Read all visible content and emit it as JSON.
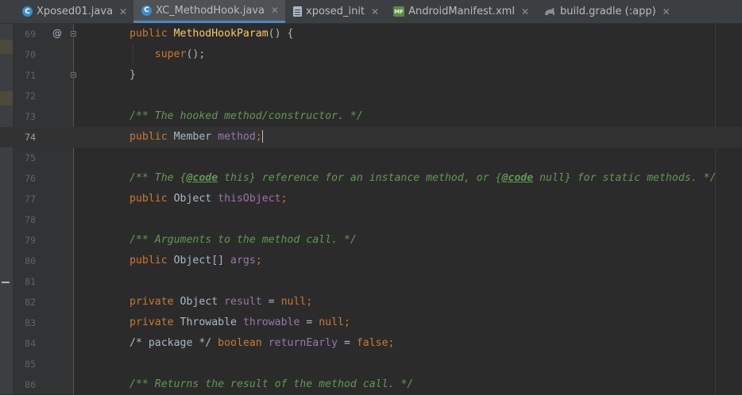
{
  "tabs": [
    {
      "label": "Xposed01.java",
      "icon": "java-class-icon",
      "active": false
    },
    {
      "label": "XC_MethodHook.java",
      "icon": "java-class-icon",
      "active": true
    },
    {
      "label": "xposed_init",
      "icon": "text-file-icon",
      "active": false
    },
    {
      "label": "AndroidManifest.xml",
      "icon": "manifest-icon",
      "active": false
    },
    {
      "label": "build.gradle (:app)",
      "icon": "gradle-icon",
      "active": false
    }
  ],
  "tab_icon_text": {
    "java": "C",
    "manifest": "MF"
  },
  "gutter": {
    "override_marker": "@"
  },
  "lines": [
    {
      "num": "69",
      "tokens": [
        [
          "kw",
          "public "
        ],
        [
          "fn",
          "MethodHookParam"
        ],
        [
          "p",
          "() {"
        ]
      ]
    },
    {
      "num": "70",
      "tokens": [
        [
          "p",
          "    "
        ],
        [
          "kw",
          "super"
        ],
        [
          "p",
          "();"
        ]
      ]
    },
    {
      "num": "71",
      "tokens": [
        [
          "p",
          "}"
        ]
      ]
    },
    {
      "num": "72",
      "tokens": []
    },
    {
      "num": "73",
      "tokens": [
        [
          "cm",
          "/** The hooked method/constructor. */"
        ]
      ]
    },
    {
      "num": "74",
      "current": true,
      "tokens": [
        [
          "kw",
          "public "
        ],
        [
          "p",
          "Member "
        ],
        [
          "fld",
          "method"
        ],
        [
          "kw",
          ";"
        ]
      ]
    },
    {
      "num": "75",
      "tokens": []
    },
    {
      "num": "76",
      "tokens": [
        [
          "cm",
          "/** The {"
        ],
        [
          "tag",
          "@code"
        ],
        [
          "cm",
          " this} reference for an instance method, or {"
        ],
        [
          "tag",
          "@code"
        ],
        [
          "cm",
          " null} for static methods. */"
        ]
      ]
    },
    {
      "num": "77",
      "tokens": [
        [
          "kw",
          "public "
        ],
        [
          "p",
          "Object "
        ],
        [
          "fld",
          "thisObject"
        ],
        [
          "kw",
          ";"
        ]
      ]
    },
    {
      "num": "78",
      "tokens": []
    },
    {
      "num": "79",
      "tokens": [
        [
          "cm",
          "/** Arguments to the method call. */"
        ]
      ]
    },
    {
      "num": "80",
      "tokens": [
        [
          "kw",
          "public "
        ],
        [
          "p",
          "Object[] "
        ],
        [
          "fld",
          "args"
        ],
        [
          "kw",
          ";"
        ]
      ]
    },
    {
      "num": "81",
      "tokens": []
    },
    {
      "num": "82",
      "tokens": [
        [
          "kw",
          "private "
        ],
        [
          "p",
          "Object "
        ],
        [
          "fld",
          "result"
        ],
        [
          "p",
          " = "
        ],
        [
          "kw",
          "null;"
        ]
      ]
    },
    {
      "num": "83",
      "tokens": [
        [
          "kw",
          "private "
        ],
        [
          "p",
          "Throwable "
        ],
        [
          "fld",
          "throwable"
        ],
        [
          "p",
          " = "
        ],
        [
          "kw",
          "null;"
        ]
      ]
    },
    {
      "num": "84",
      "tokens": [
        [
          "p",
          "/* package */ "
        ],
        [
          "kw",
          "boolean "
        ],
        [
          "fld",
          "returnEarly"
        ],
        [
          "p",
          " = "
        ],
        [
          "kw",
          "false;"
        ]
      ]
    },
    {
      "num": "85",
      "tokens": []
    },
    {
      "num": "86",
      "tokens": [
        [
          "cm",
          "/** Returns the result of the method call. */"
        ]
      ]
    }
  ]
}
